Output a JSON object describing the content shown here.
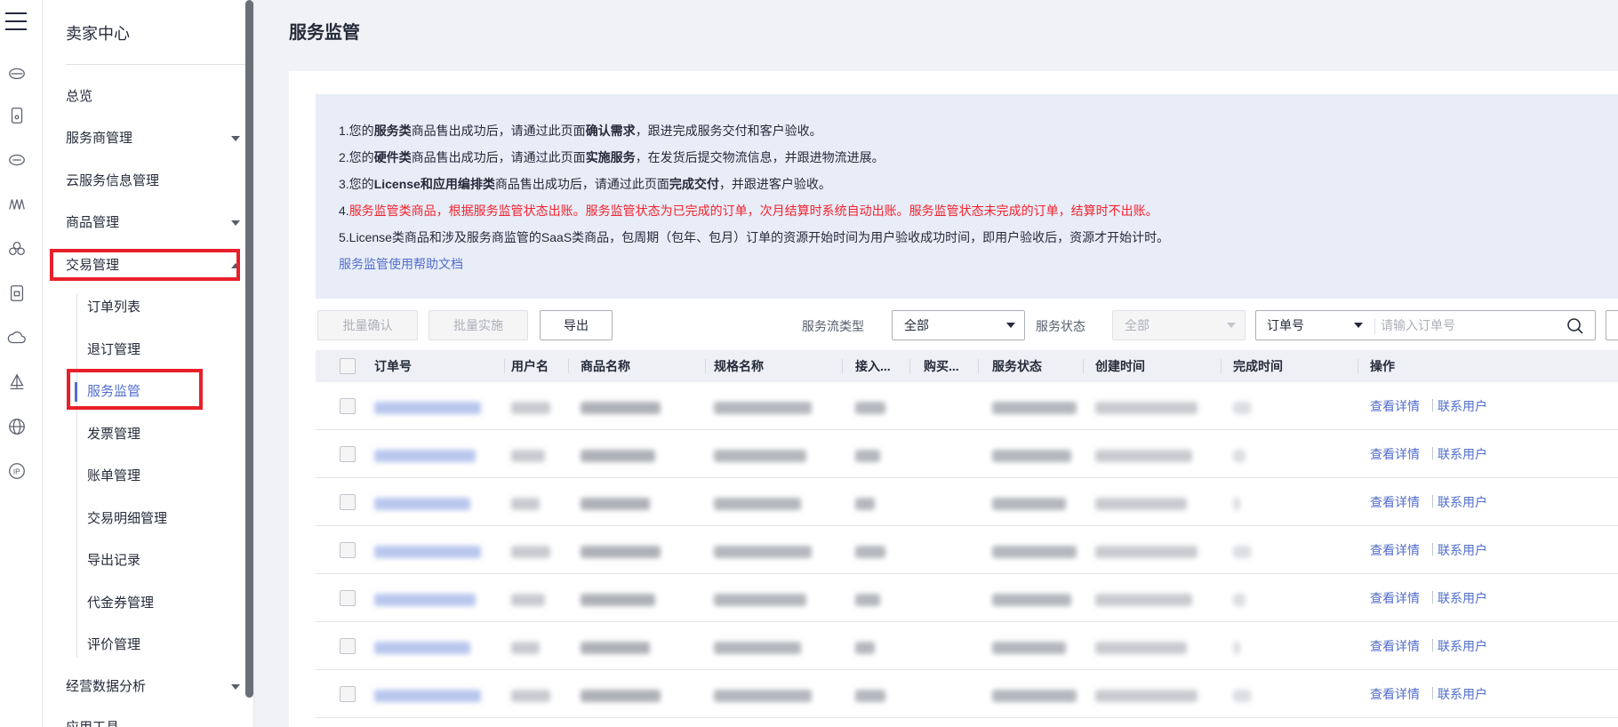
{
  "rail": {
    "icons": [
      "menu-icon",
      "cloud-disk-icon",
      "device-icon",
      "cloud-server-icon",
      "algorithm-icon",
      "cluster-icon",
      "document-icon",
      "cloud-icon",
      "sailboat-icon",
      "globe-icon",
      "ip-icon"
    ]
  },
  "sidebar": {
    "title": "卖家中心",
    "items": [
      {
        "label": "总览"
      },
      {
        "label": "服务商管理"
      },
      {
        "label": "云服务信息管理"
      },
      {
        "label": "商品管理"
      },
      {
        "label": "交易管理"
      },
      {
        "label": "经营数据分析"
      },
      {
        "label": "应用工具"
      }
    ],
    "sub_items": [
      {
        "label": "订单列表"
      },
      {
        "label": "退订管理"
      },
      {
        "label": "服务监管",
        "active": true
      },
      {
        "label": "发票管理"
      },
      {
        "label": "账单管理"
      },
      {
        "label": "交易明细管理"
      },
      {
        "label": "导出记录"
      },
      {
        "label": "代金券管理"
      },
      {
        "label": "评价管理"
      }
    ]
  },
  "page": {
    "title": "服务监管"
  },
  "notice": {
    "line1": {
      "a": "1.您的",
      "b": "服务类",
      "c": "商品售出成功后，请通过此页面",
      "d": "确认需求",
      "e": "，跟进完成服务交付和客户验收。"
    },
    "line2": {
      "a": "2.您的",
      "b": "硬件类",
      "c": "商品售出成功后，请通过此页面",
      "d": "实施服务",
      "e": "，在发货后提交物流信息，并跟进物流进展。"
    },
    "line3": {
      "a": "3.您的",
      "b": "License和应用编排类",
      "c": "商品售出成功后，请通过此页面",
      "d": "完成交付",
      "e": "，并跟进客户验收。"
    },
    "line4": {
      "a": "4.",
      "b": "服务监管类商品，根据服务监管状态出账。服务监管状态为已完成的订单，次月结算时系统自动出账。服务监管状态未完成的订单，结算时不出账。"
    },
    "line5": "5.License类商品和涉及服务商监管的SaaS类商品，包周期（包年、包月）订单的资源开始时间为用户验收成功时间，即用户验收后，资源才开始计时。",
    "help_link": "服务监管使用帮助文档",
    "accent_color": "#f5222d"
  },
  "toolbar": {
    "batch_confirm": "批量确认",
    "batch_implement": "批量实施",
    "export": "导出",
    "flow_type_label": "服务流类型",
    "flow_type_value": "全部",
    "status_label": "服务状态",
    "status_value": "全部",
    "search_field": "订单号",
    "search_placeholder": "请输入订单号"
  },
  "table": {
    "headers": [
      "订单号",
      "用户名",
      "商品名称",
      "规格名称",
      "接入...",
      "购买...",
      "服务状态",
      "创建时间",
      "完成时间",
      "操作"
    ],
    "rows": [
      {
        "ops": [
          "查看详情",
          "联系用户"
        ]
      },
      {
        "ops": [
          "查看详情",
          "联系用户"
        ]
      },
      {
        "ops": [
          "查看详情",
          "联系用户"
        ]
      },
      {
        "ops": [
          "查看详情",
          "联系用户"
        ]
      },
      {
        "ops": [
          "查看详情",
          "联系用户"
        ]
      },
      {
        "ops": [
          "查看详情",
          "联系用户"
        ]
      },
      {
        "ops": [
          "查看详情",
          "联系用户"
        ]
      }
    ]
  }
}
